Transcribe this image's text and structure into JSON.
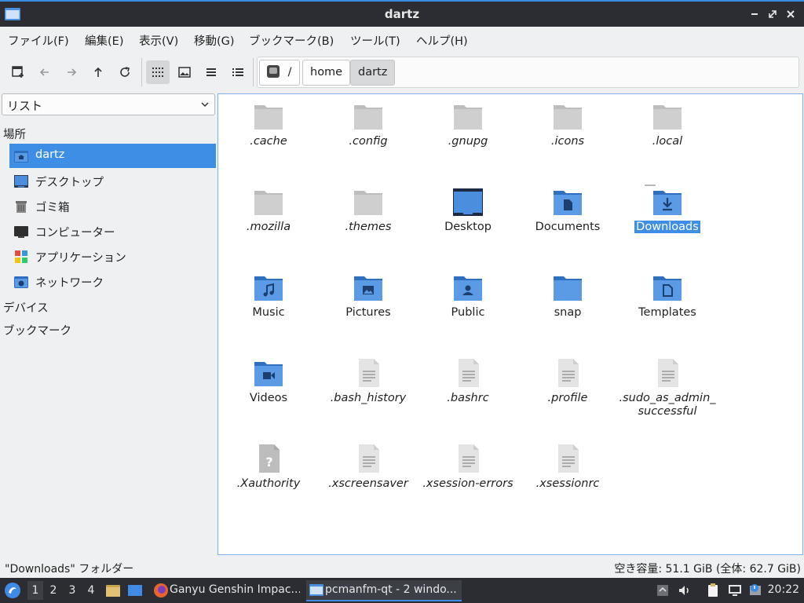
{
  "window": {
    "title": "dartz"
  },
  "menu": [
    "ファイル(F)",
    "編集(E)",
    "表示(V)",
    "移動(G)",
    "ブックマーク(B)",
    "ツール(T)",
    "ヘルプ(H)"
  ],
  "toolbar": {
    "buttons": [
      "new-tab-icon",
      "back-icon",
      "forward-icon",
      "up-icon",
      "reload-icon",
      "icon-view-icon",
      "thumbnail-view-icon",
      "compact-view-icon",
      "detailed-list-icon"
    ],
    "active_view": "icon-view"
  },
  "path": {
    "root": "/",
    "crumbs": [
      "home",
      "dartz"
    ]
  },
  "side": {
    "mode": "リスト",
    "places_header": "場所",
    "places": [
      {
        "label": "dartz",
        "icon": "home-folder-icon",
        "selected": true
      },
      {
        "label": "デスクトップ",
        "icon": "desktop-icon",
        "selected": false
      },
      {
        "label": "ゴミ箱",
        "icon": "trash-icon",
        "selected": false
      },
      {
        "label": "コンピューター",
        "icon": "computer-icon",
        "selected": false
      },
      {
        "label": "アプリケーション",
        "icon": "applications-icon",
        "selected": false
      },
      {
        "label": "ネットワーク",
        "icon": "network-icon",
        "selected": false
      }
    ],
    "devices_header": "デバイス",
    "bookmarks_header": "ブックマーク"
  },
  "files": [
    {
      "name": ".cache",
      "kind": "hidden-folder"
    },
    {
      "name": ".config",
      "kind": "hidden-folder"
    },
    {
      "name": ".gnupg",
      "kind": "hidden-folder"
    },
    {
      "name": ".icons",
      "kind": "hidden-folder"
    },
    {
      "name": ".local",
      "kind": "hidden-folder"
    },
    {
      "name": ".mozilla",
      "kind": "hidden-folder"
    },
    {
      "name": ".themes",
      "kind": "hidden-folder"
    },
    {
      "name": "Desktop",
      "kind": "desktop"
    },
    {
      "name": "Documents",
      "kind": "documents"
    },
    {
      "name": "Downloads",
      "kind": "downloads",
      "selected": true
    },
    {
      "name": "Music",
      "kind": "music"
    },
    {
      "name": "Pictures",
      "kind": "pictures"
    },
    {
      "name": "Public",
      "kind": "public"
    },
    {
      "name": "snap",
      "kind": "folder"
    },
    {
      "name": "Templates",
      "kind": "templates"
    },
    {
      "name": "Videos",
      "kind": "videos"
    },
    {
      "name": ".bash_history",
      "kind": "hidden-text"
    },
    {
      "name": ".bashrc",
      "kind": "hidden-text"
    },
    {
      "name": ".profile",
      "kind": "hidden-text"
    },
    {
      "name": ".sudo_as_admin_successful",
      "kind": "hidden-text",
      "display": [
        ".sudo_as_admin_",
        "successful"
      ]
    },
    {
      "name": ".Xauthority",
      "kind": "hidden-unknown"
    },
    {
      "name": ".xscreensaver",
      "kind": "hidden-text"
    },
    {
      "name": ".xsession-errors",
      "kind": "hidden-text"
    },
    {
      "name": ".xsessionrc",
      "kind": "hidden-text"
    }
  ],
  "status": {
    "selection": "\"Downloads\" フォルダー",
    "free_space": "空き容量: 51.1 GiB (全体: 62.7 GiB)"
  },
  "taskbar": {
    "desktops": [
      "1",
      "2",
      "3",
      "4"
    ],
    "active_desktop": "1",
    "tasks": [
      {
        "label": "Ganyu Genshin Impac...",
        "icon": "firefox-icon",
        "active": false
      },
      {
        "label": "pcmanfm-qt - 2 windo...",
        "icon": "folder-icon",
        "active": true
      }
    ],
    "clock": "20:22"
  },
  "colors": {
    "accent": "#3e8ee6",
    "folder_blue": "#4a8fdd",
    "hidden_folder": "#c9c9c9",
    "titlebar": "#2b2d33"
  }
}
